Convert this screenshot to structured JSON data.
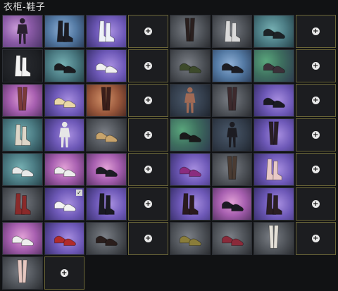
{
  "title": "衣柜-鞋子",
  "slots": [
    {
      "bg": "purple",
      "kind": "figure",
      "color": "#2a2030"
    },
    {
      "bg": "blue",
      "kind": "boots",
      "color": "#1b1b22"
    },
    {
      "bg": "violet",
      "kind": "boots",
      "color": "#eef2f8"
    },
    {
      "bg": "dark",
      "kind": "empty"
    },
    {
      "bg": "grey",
      "kind": "legs",
      "color": "#2a1f1e"
    },
    {
      "bg": "grey",
      "kind": "boots",
      "color": "#d9d9d9"
    },
    {
      "bg": "teal",
      "kind": "shoes",
      "color": "#1d2226"
    },
    {
      "bg": "dark",
      "kind": "empty"
    },
    {
      "bg": "dark",
      "kind": "boots",
      "color": "#f2f2f2"
    },
    {
      "bg": "teal",
      "kind": "shoes",
      "color": "#1b1b1f"
    },
    {
      "bg": "violet",
      "kind": "shoes",
      "color": "#f0f0f0"
    },
    {
      "bg": "dark",
      "kind": "empty"
    },
    {
      "bg": "grey",
      "kind": "shoes",
      "color": "#3d4a2b"
    },
    {
      "bg": "blue",
      "kind": "shoes",
      "color": "#1c1c22"
    },
    {
      "bg": "green",
      "kind": "shoes",
      "color": "#3b3038"
    },
    {
      "bg": "dark",
      "kind": "empty"
    },
    {
      "bg": "pink",
      "kind": "legs",
      "color": "#7a3a3a"
    },
    {
      "bg": "violet",
      "kind": "shoes",
      "color": "#e9d7a7"
    },
    {
      "bg": "orange",
      "kind": "legs",
      "color": "#3a1e1a"
    },
    {
      "bg": "dark",
      "kind": "empty"
    },
    {
      "bg": "slate",
      "kind": "figure",
      "color": "#a06a55"
    },
    {
      "bg": "grey",
      "kind": "legs",
      "color": "#3d2a2d"
    },
    {
      "bg": "violet",
      "kind": "shoes",
      "color": "#1a1a22"
    },
    {
      "bg": "dark",
      "kind": "empty"
    },
    {
      "bg": "teal",
      "kind": "boots",
      "color": "#ddd6c8"
    },
    {
      "bg": "violet",
      "kind": "figure",
      "color": "#e6e6e6"
    },
    {
      "bg": "grey",
      "kind": "shoes",
      "color": "#c8a46c"
    },
    {
      "bg": "dark",
      "kind": "empty"
    },
    {
      "bg": "green",
      "kind": "shoes",
      "color": "#1a1a1a"
    },
    {
      "bg": "slate",
      "kind": "figure",
      "color": "#1c1c22"
    },
    {
      "bg": "violet",
      "kind": "legs",
      "color": "#2a1e26"
    },
    {
      "bg": "dark",
      "kind": "empty"
    },
    {
      "bg": "teal",
      "kind": "shoes",
      "color": "#e8e8e8"
    },
    {
      "bg": "pink",
      "kind": "shoes",
      "color": "#ededed"
    },
    {
      "bg": "pink",
      "kind": "shoes",
      "color": "#1d1d24"
    },
    {
      "bg": "dark",
      "kind": "empty"
    },
    {
      "bg": "violet",
      "kind": "shoes",
      "color": "#8a2c7e"
    },
    {
      "bg": "grey",
      "kind": "legs",
      "color": "#4a3b32"
    },
    {
      "bg": "violet",
      "kind": "boots",
      "color": "#e7c8c6"
    },
    {
      "bg": "dark",
      "kind": "empty"
    },
    {
      "bg": "grey",
      "kind": "boots",
      "color": "#8a2a2a"
    },
    {
      "bg": "violet",
      "kind": "shoes",
      "color": "#f2f2f2",
      "checked": true
    },
    {
      "bg": "violet",
      "kind": "boots",
      "color": "#1a1a22"
    },
    {
      "bg": "dark",
      "kind": "empty"
    },
    {
      "bg": "violet",
      "kind": "boots",
      "color": "#2a1a1e"
    },
    {
      "bg": "pink",
      "kind": "shoes",
      "color": "#1a1a22"
    },
    {
      "bg": "violet",
      "kind": "boots",
      "color": "#2b1e23"
    },
    {
      "bg": "dark",
      "kind": "empty"
    },
    {
      "bg": "pink",
      "kind": "shoes",
      "color": "#eeeeee"
    },
    {
      "bg": "violet",
      "kind": "shoes",
      "color": "#b02b2b"
    },
    {
      "bg": "grey",
      "kind": "shoes",
      "color": "#2a1e1c"
    },
    {
      "bg": "dark",
      "kind": "empty"
    },
    {
      "bg": "grey",
      "kind": "shoes",
      "color": "#8a7d3a"
    },
    {
      "bg": "grey",
      "kind": "shoes",
      "color": "#8a2a3a"
    },
    {
      "bg": "grey",
      "kind": "legs",
      "color": "#e4e0d8"
    },
    {
      "bg": "dark",
      "kind": "empty"
    },
    {
      "bg": "grey",
      "kind": "legs",
      "color": "#e5c7c0"
    },
    {
      "bg": "dark",
      "kind": "empty"
    }
  ]
}
